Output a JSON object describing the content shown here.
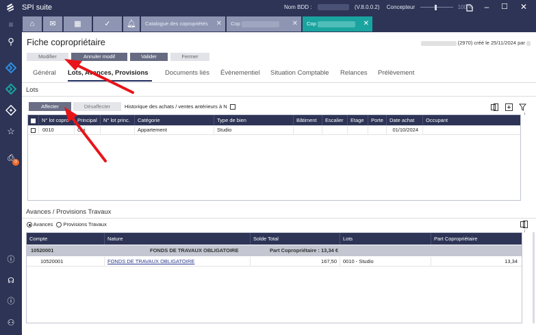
{
  "app": {
    "title": "SPI suite",
    "bdd_label": "Nom BDD :",
    "version": "(V.8.0.0.2)",
    "role": "Concepteur",
    "zoom": "100 %"
  },
  "tabs": [
    {
      "label": "Catalogue des copropriétés"
    },
    {
      "label": "Cop"
    },
    {
      "label": "Cop"
    }
  ],
  "form": {
    "title": "Fiche copropriétaire",
    "info": "(2970) créé le 25/11/2024 par"
  },
  "toolbar": {
    "modifier": "Modifier",
    "annuler": "Annuler modif",
    "valider": "Valider",
    "fermer": "Fermer"
  },
  "nav": [
    "Général",
    "Lots, Avances, Provisions",
    "Documents liés",
    "Évènementiel",
    "Situation Comptable",
    "Relances",
    "Prélèvement"
  ],
  "lots": {
    "section": "Lots",
    "affecter": "Affecter",
    "desaffecter": "Désaffecter",
    "historique": "Historique des achats / ventes antérieurs à N",
    "columns": [
      "N° lot copro",
      "Principal",
      "N° lot princ.",
      "Catégorie",
      "Type de bien",
      "Bâtiment",
      "Escalier",
      "Etage",
      "Porte",
      "Date achat",
      "Occupant"
    ],
    "rows": [
      {
        "lot": "0010",
        "principal": "Oui",
        "lot_princ": "",
        "categorie": "Appartement",
        "type": "Studio",
        "batiment": "",
        "escalier": "",
        "etage": "",
        "porte": "",
        "date": "01/10/2024",
        "occupant": ""
      }
    ]
  },
  "avances": {
    "section": "Avances / Provisions Travaux",
    "radio_avances": "Avances",
    "radio_provisions": "Provisions Travaux",
    "columns": [
      "Compte",
      "Nature",
      "Solde Total",
      "Lots",
      "Part Copropriétaire"
    ],
    "group": {
      "compte": "10520001",
      "nature": "FONDS DE TRAVAUX OBLIGATOIRE",
      "part": "Part Copropriétaire :  13,34 €"
    },
    "rows": [
      {
        "compte": "10520001",
        "nature": "FONDS DE TRAVAUX OBLIGATOIRE",
        "solde": "167,50",
        "lots": "0010 - Studio",
        "part": "13,34"
      }
    ]
  },
  "badge": "0",
  "colors": {
    "sidebar": "#2d3456",
    "active_tab": "#1aa4a0",
    "header": "#2d3456",
    "arrow": "#e8141a"
  }
}
